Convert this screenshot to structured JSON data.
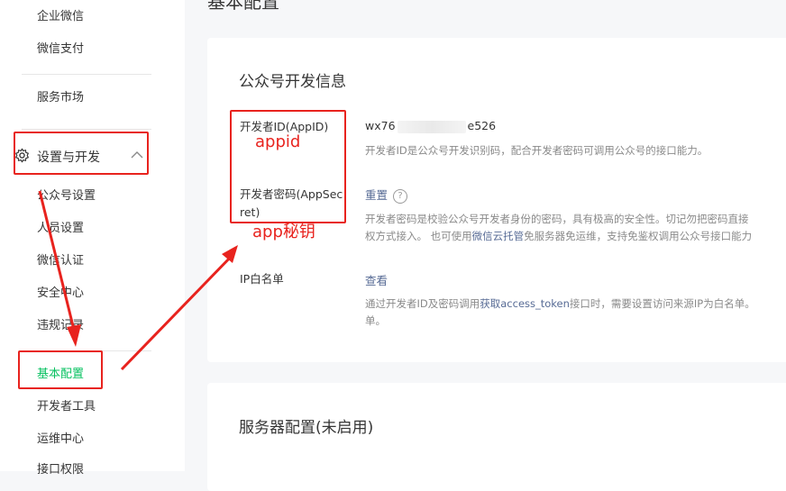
{
  "sidebar": {
    "items_top": [
      {
        "label": "企业微信"
      },
      {
        "label": "微信支付"
      },
      {
        "label": "服务市场"
      }
    ],
    "group": {
      "label": "设置与开发",
      "icon": "gear-icon"
    },
    "group_items": [
      {
        "label": "公众号设置"
      },
      {
        "label": "人员设置"
      },
      {
        "label": "微信认证"
      },
      {
        "label": "安全中心"
      },
      {
        "label": "违规记录"
      }
    ],
    "active_item": {
      "label": "基本配置"
    },
    "items_bottom": [
      {
        "label": "开发者工具"
      },
      {
        "label": "运维中心"
      },
      {
        "label": "接口权限"
      }
    ]
  },
  "main": {
    "page_title": "基本配置",
    "dev_info": {
      "title": "公众号开发信息",
      "appid": {
        "label": "开发者ID(AppID)",
        "value_prefix": "wx76",
        "value_suffix": "e526",
        "desc": "开发者ID是公众号开发识别码，配合开发者密码可调用公众号的接口能力。"
      },
      "appsecret": {
        "label_line1": "开发者密码(AppSec",
        "label_line2": "ret)",
        "action": "重置",
        "help": "?",
        "desc_line1": "开发者密码是校验公众号开发者身份的密码，具有极高的安全性。切记勿把密码直接",
        "desc_line2_a": "权方式接入。 也可使用",
        "desc_line2_link": "微信云托管",
        "desc_line2_b": "免服务器免运维，支持免鉴权调用公众号接口能力"
      },
      "ip_whitelist": {
        "label": "IP白名单",
        "action": "查看",
        "desc_line1_a": "通过开发者ID及密码调用",
        "desc_line1_link": "获取access_token",
        "desc_line1_b": "接口时，需要设置访问来源IP为白名单。",
        "desc_line2": "单。"
      }
    },
    "server_config": {
      "title": "服务器配置(未启用)"
    }
  },
  "annotations": {
    "appid": "appid",
    "appsecret": "app秘钥",
    "color": "#e8231e"
  }
}
